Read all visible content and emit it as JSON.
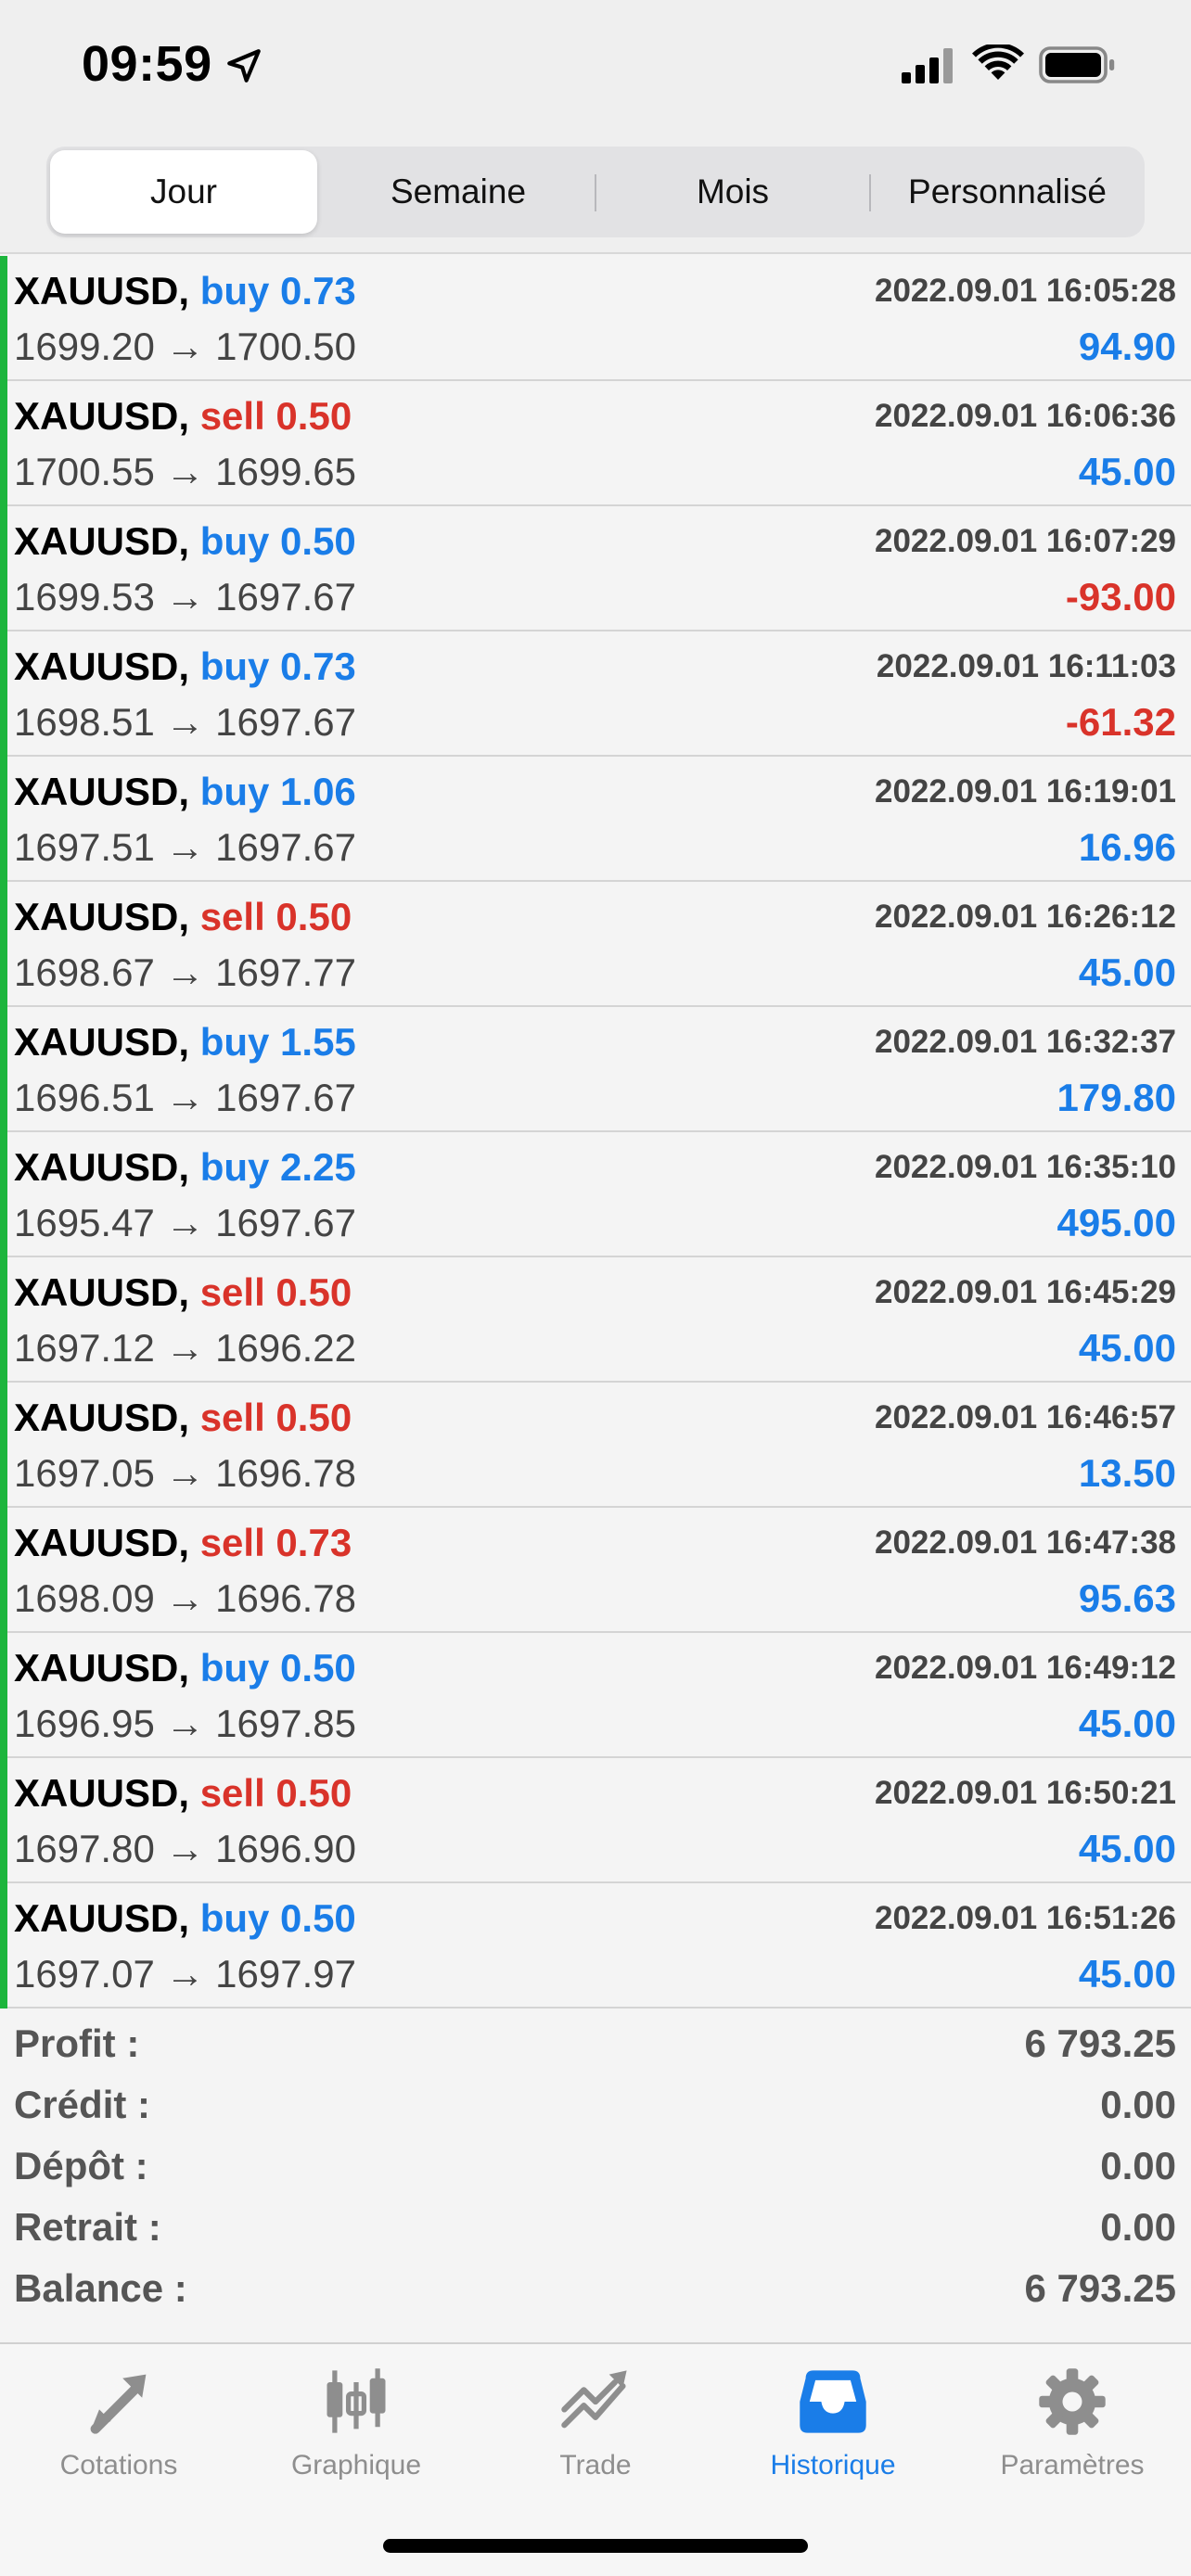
{
  "status": {
    "time": "09:59"
  },
  "segments": [
    {
      "label": "Jour",
      "active": true
    },
    {
      "label": "Semaine",
      "active": false
    },
    {
      "label": "Mois",
      "active": false
    },
    {
      "label": "Personnalisé",
      "active": false
    }
  ],
  "trades": [
    {
      "symbol": "XAUUSD,",
      "side": "buy",
      "volume": "buy 0.73",
      "time": "2022.09.01 16:05:28",
      "prices": "1699.20 → 1700.50",
      "profit": "94.90"
    },
    {
      "symbol": "XAUUSD,",
      "side": "sell",
      "volume": "sell 0.50",
      "time": "2022.09.01 16:06:36",
      "prices": "1700.55 → 1699.65",
      "profit": "45.00"
    },
    {
      "symbol": "XAUUSD,",
      "side": "buy",
      "volume": "buy 0.50",
      "time": "2022.09.01 16:07:29",
      "prices": "1699.53 → 1697.67",
      "profit": "-93.00"
    },
    {
      "symbol": "XAUUSD,",
      "side": "buy",
      "volume": "buy 0.73",
      "time": "2022.09.01 16:11:03",
      "prices": "1698.51 → 1697.67",
      "profit": "-61.32"
    },
    {
      "symbol": "XAUUSD,",
      "side": "buy",
      "volume": "buy 1.06",
      "time": "2022.09.01 16:19:01",
      "prices": "1697.51 → 1697.67",
      "profit": "16.96"
    },
    {
      "symbol": "XAUUSD,",
      "side": "sell",
      "volume": "sell 0.50",
      "time": "2022.09.01 16:26:12",
      "prices": "1698.67 → 1697.77",
      "profit": "45.00"
    },
    {
      "symbol": "XAUUSD,",
      "side": "buy",
      "volume": "buy 1.55",
      "time": "2022.09.01 16:32:37",
      "prices": "1696.51 → 1697.67",
      "profit": "179.80"
    },
    {
      "symbol": "XAUUSD,",
      "side": "buy",
      "volume": "buy 2.25",
      "time": "2022.09.01 16:35:10",
      "prices": "1695.47 → 1697.67",
      "profit": "495.00"
    },
    {
      "symbol": "XAUUSD,",
      "side": "sell",
      "volume": "sell 0.50",
      "time": "2022.09.01 16:45:29",
      "prices": "1697.12 → 1696.22",
      "profit": "45.00"
    },
    {
      "symbol": "XAUUSD,",
      "side": "sell",
      "volume": "sell 0.50",
      "time": "2022.09.01 16:46:57",
      "prices": "1697.05 → 1696.78",
      "profit": "13.50"
    },
    {
      "symbol": "XAUUSD,",
      "side": "sell",
      "volume": "sell 0.73",
      "time": "2022.09.01 16:47:38",
      "prices": "1698.09 → 1696.78",
      "profit": "95.63"
    },
    {
      "symbol": "XAUUSD,",
      "side": "buy",
      "volume": "buy 0.50",
      "time": "2022.09.01 16:49:12",
      "prices": "1696.95 → 1697.85",
      "profit": "45.00"
    },
    {
      "symbol": "XAUUSD,",
      "side": "sell",
      "volume": "sell 0.50",
      "time": "2022.09.01 16:50:21",
      "prices": "1697.80 → 1696.90",
      "profit": "45.00"
    },
    {
      "symbol": "XAUUSD,",
      "side": "buy",
      "volume": "buy 0.50",
      "time": "2022.09.01 16:51:26",
      "prices": "1697.07 → 1697.97",
      "profit": "45.00"
    }
  ],
  "summary": [
    {
      "label": "Profit :",
      "value": "6 793.25"
    },
    {
      "label": "Crédit :",
      "value": "0.00"
    },
    {
      "label": "Dépôt :",
      "value": "0.00"
    },
    {
      "label": "Retrait :",
      "value": "0.00"
    },
    {
      "label": "Balance :",
      "value": "6 793.25"
    }
  ],
  "tabs": [
    {
      "label": "Cotations",
      "icon": "quotes-arrows-icon",
      "active": false
    },
    {
      "label": "Graphique",
      "icon": "candlestick-chart-icon",
      "active": false
    },
    {
      "label": "Trade",
      "icon": "trade-trend-icon",
      "active": false
    },
    {
      "label": "Historique",
      "icon": "history-inbox-icon",
      "active": true
    },
    {
      "label": "Paramètres",
      "icon": "gear-icon",
      "active": false
    }
  ],
  "colors": {
    "buy": "#1a7de8",
    "sell": "#d9332a",
    "indicator": "#1db53d",
    "tab_inactive": "#8e8e8e",
    "tab_active": "#1a7de8"
  }
}
